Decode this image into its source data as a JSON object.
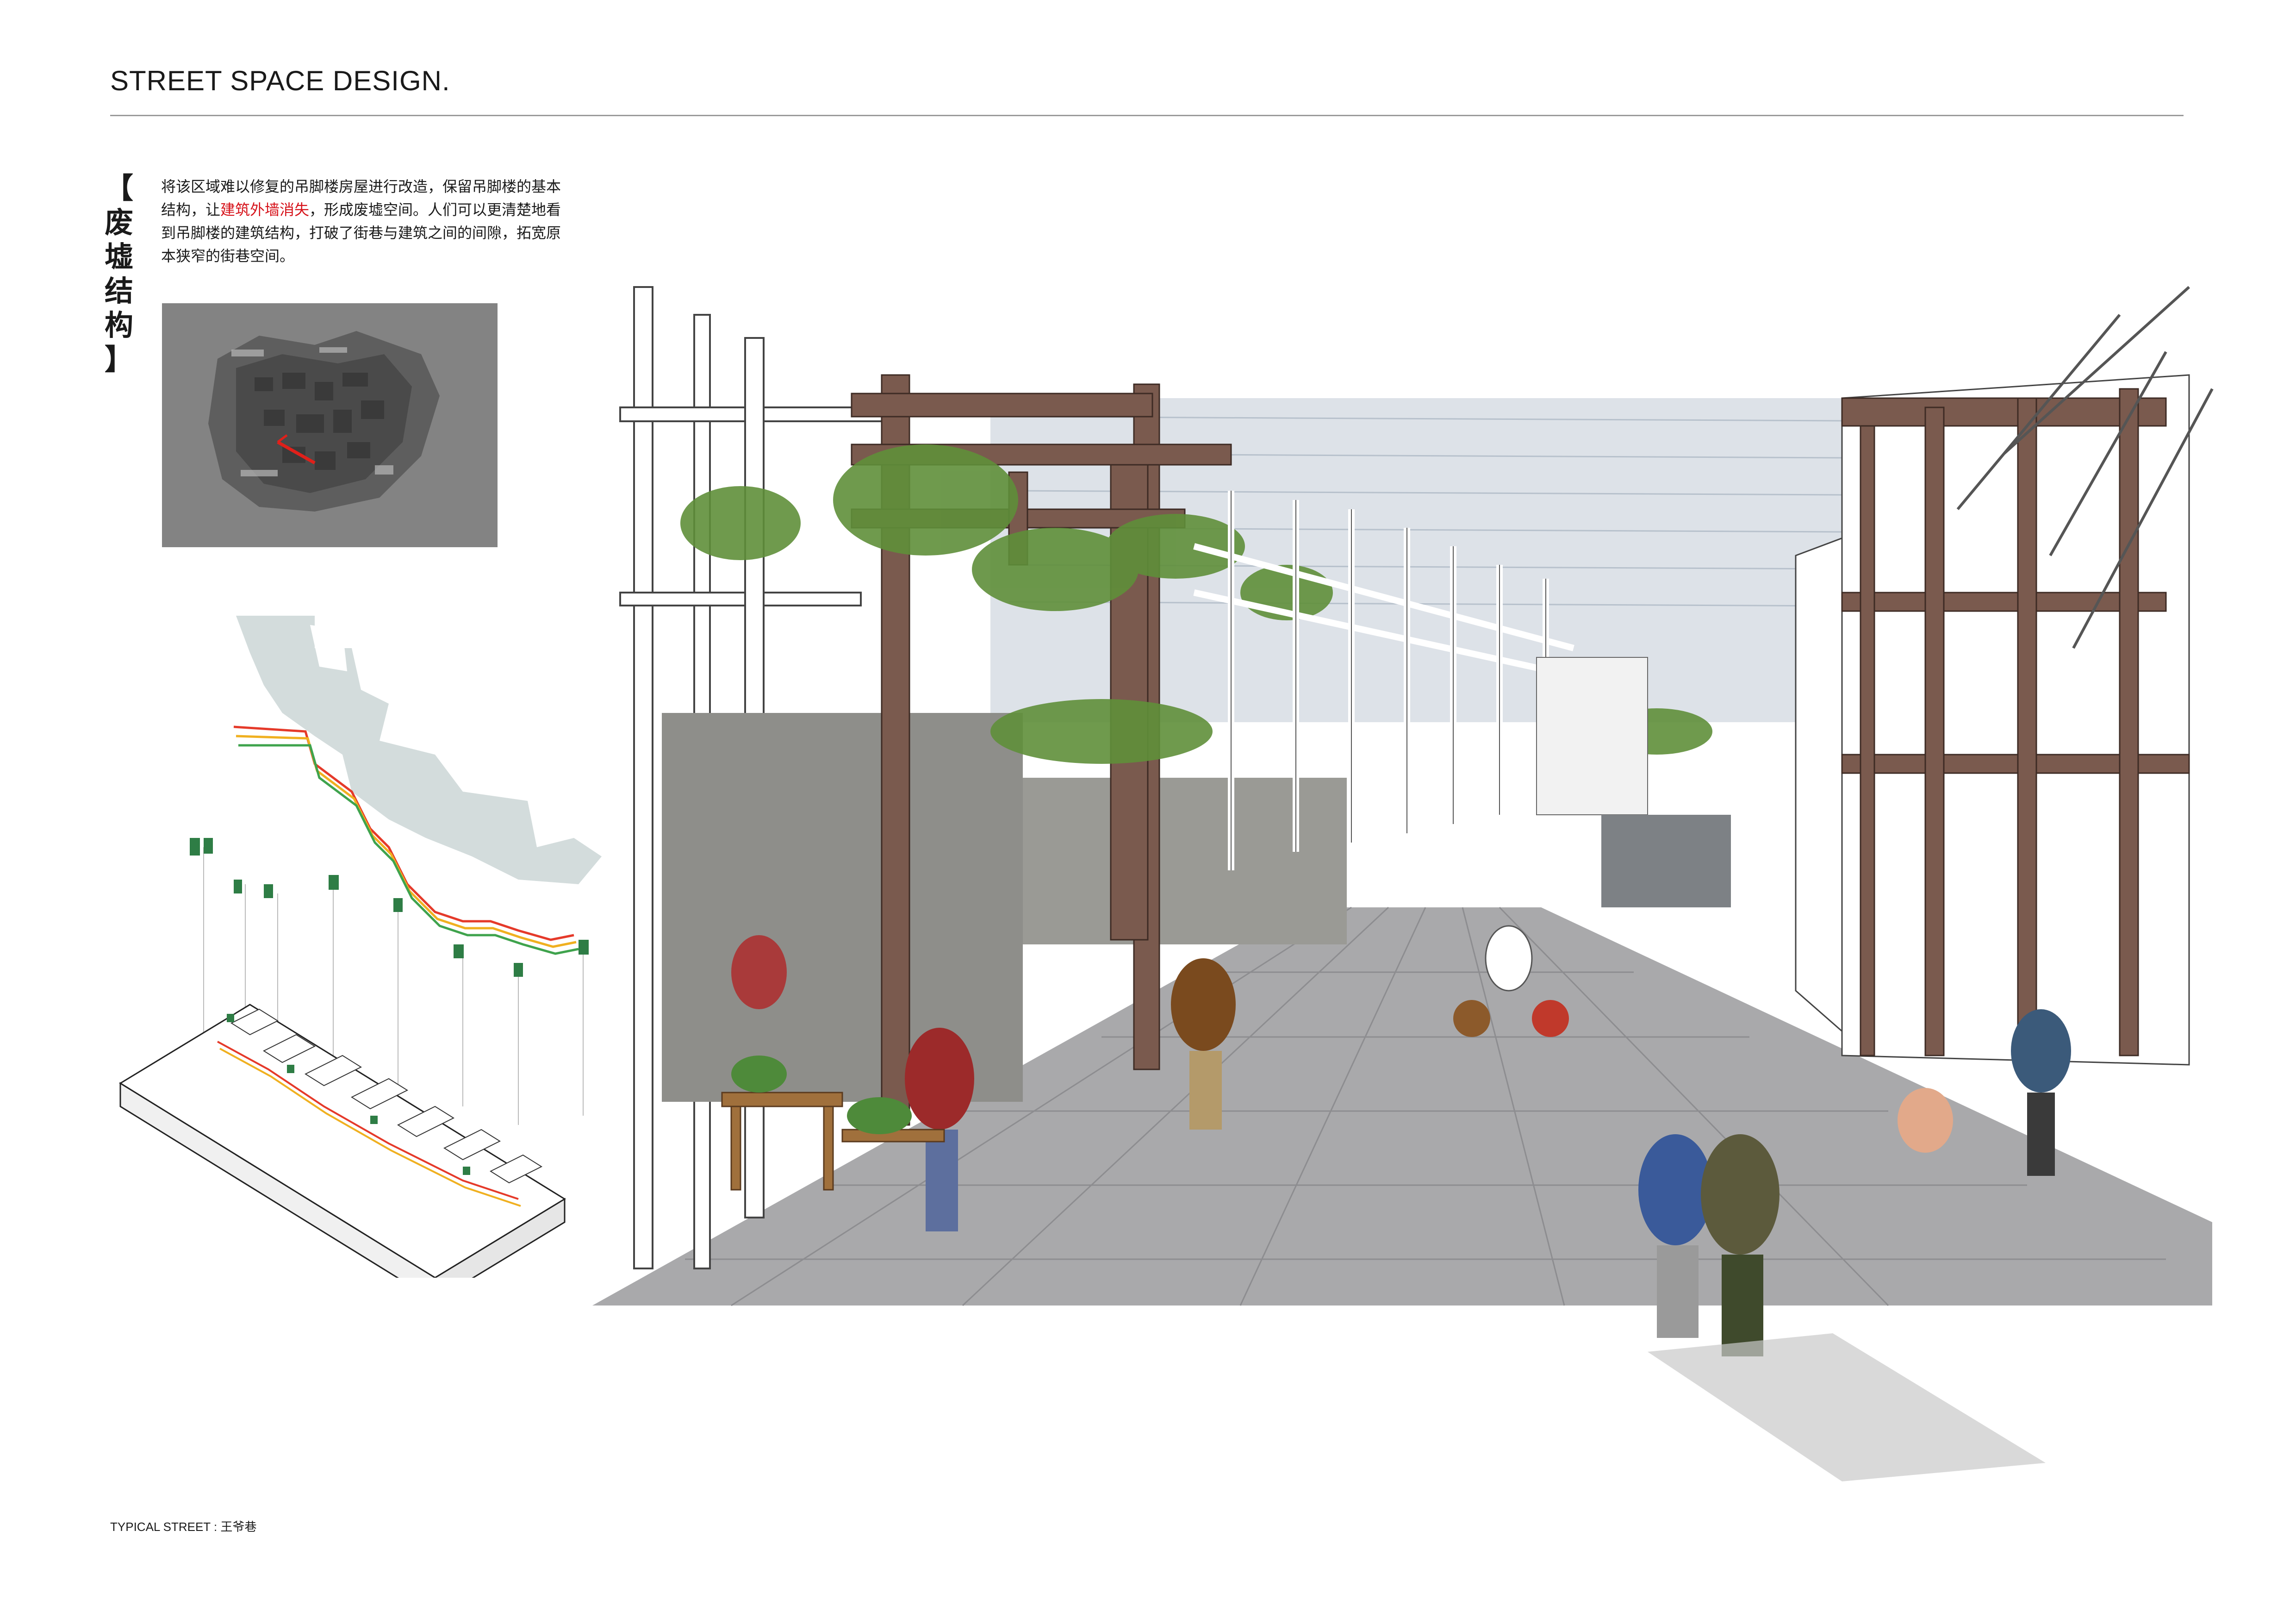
{
  "header": {
    "title": "STREET SPACE DESIGN."
  },
  "section": {
    "vertical_title": [
      "【",
      "废",
      "墟",
      "结",
      "构",
      "】"
    ],
    "description": {
      "part1": "将该区域难以修复的吊脚楼房屋进行改造，保留吊脚楼的基本结构，让",
      "highlight": "建筑外墙消失",
      "part2": "，形成废墟空间。人们可以更清楚地看到吊脚楼的建筑结构，打破了街巷与建筑之间的间隙，拓宽原本狭窄的街巷空间。"
    },
    "highlight_color": "#d6121a"
  },
  "images": {
    "aerial": "aerial-site-map",
    "axo": "axonometric-diagram",
    "perspective": "street-perspective-rendering"
  },
  "footer": {
    "caption": "TYPICAL STREET : 王爷巷"
  }
}
